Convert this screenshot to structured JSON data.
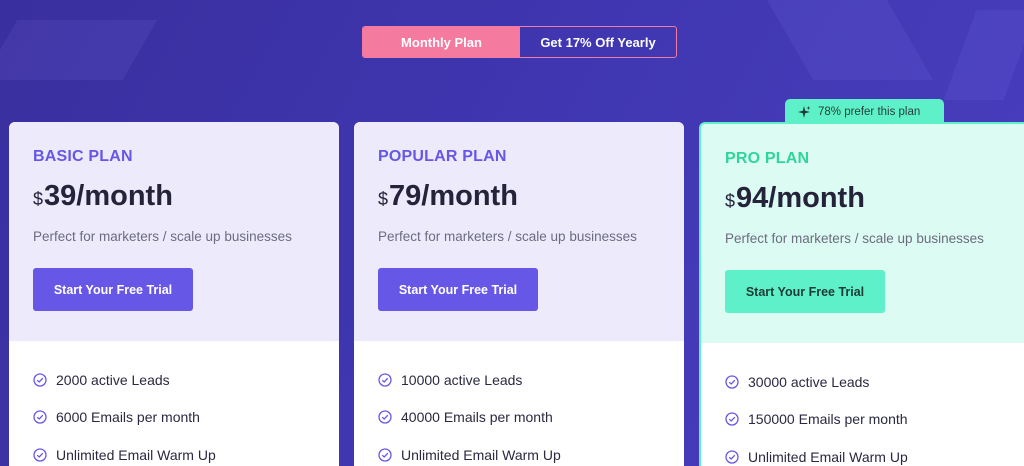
{
  "billing_toggle": {
    "monthly_label": "Monthly Plan",
    "yearly_label": "Get 17% Off Yearly"
  },
  "pro_badge": {
    "text": "78% prefer this plan",
    "icon": "sparkle-icon"
  },
  "plans": [
    {
      "name": "BASIC PLAN",
      "currency": "$",
      "price": "39/month",
      "description": "Perfect for marketers / scale up businesses",
      "cta": "Start Your Free Trial",
      "features": [
        "2000 active Leads",
        "6000 Emails per month",
        "Unlimited Email Warm Up"
      ]
    },
    {
      "name": "POPULAR PLAN",
      "currency": "$",
      "price": "79/month",
      "description": "Perfect for marketers / scale up businesses",
      "cta": "Start Your Free Trial",
      "features": [
        "10000 active Leads",
        "40000 Emails per month",
        "Unlimited Email Warm Up"
      ]
    },
    {
      "name": "PRO PLAN",
      "currency": "$",
      "price": "94/month",
      "description": "Perfect for marketers / scale up businesses",
      "cta": "Start Your Free Trial",
      "features": [
        "30000 active Leads",
        "150000 Emails per month",
        "Unlimited Email Warm Up"
      ]
    }
  ],
  "colors": {
    "background": "#3f36b0",
    "accent": "#6757e6",
    "pink": "#f47a9f",
    "mint": "#5ef0c8"
  }
}
